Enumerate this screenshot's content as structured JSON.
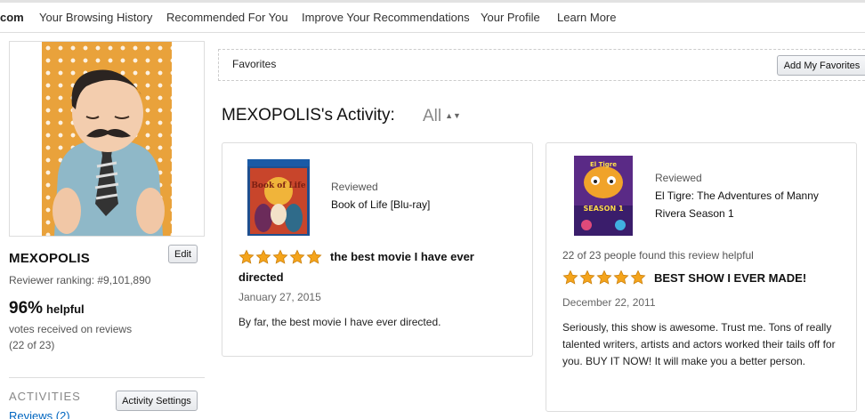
{
  "nav": {
    "brand": "com",
    "items": [
      "Your Browsing History",
      "Recommended For You",
      "Improve Your Recommendations",
      "Your Profile",
      "Learn More"
    ]
  },
  "profile": {
    "name": "MEXOPOLIS",
    "edit_label": "Edit",
    "ranking": "Reviewer ranking: #9,101,890",
    "helpful_pct": "96%",
    "helpful_word": "helpful",
    "votes_text": "votes received on reviews",
    "votes_count": "(22 of 23)",
    "activities_heading": "ACTIVITIES",
    "activity_settings_label": "Activity Settings",
    "reviews_link": "Reviews (2)"
  },
  "favorites": {
    "label": "Favorites",
    "add_button": "Add My Favorites"
  },
  "activity": {
    "title": "MEXOPOLIS's Activity:",
    "filter": "All",
    "filter_caret": "▲▼"
  },
  "cards": [
    {
      "reviewed_label": "Reviewed",
      "product": "Book of Life [Blu-ray]",
      "found_helpful": "",
      "rating": 5,
      "headline": "the best movie I have ever directed",
      "date": "January 27, 2015",
      "body": "By far, the best movie I have ever directed.",
      "cover_title": "Book of Life"
    },
    {
      "reviewed_label": "Reviewed",
      "product": "El Tigre: The Adventures of Manny Rivera Season 1",
      "found_helpful": "22 of 23 people found this review helpful",
      "rating": 5,
      "headline": "BEST SHOW I EVER MADE!",
      "date": "December 22, 2011",
      "body": "Seriously, this show is awesome. Trust me. Tons of really talented writers, artists and actors worked their tails off for you. BUY IT NOW! It will make you a better person.",
      "cover_title": "El Tigre",
      "cover_subtitle": "SEASON 1"
    }
  ],
  "colors": {
    "link": "#0066c0",
    "star": "#f4a41c",
    "photo_bg": "#e9a23b"
  }
}
